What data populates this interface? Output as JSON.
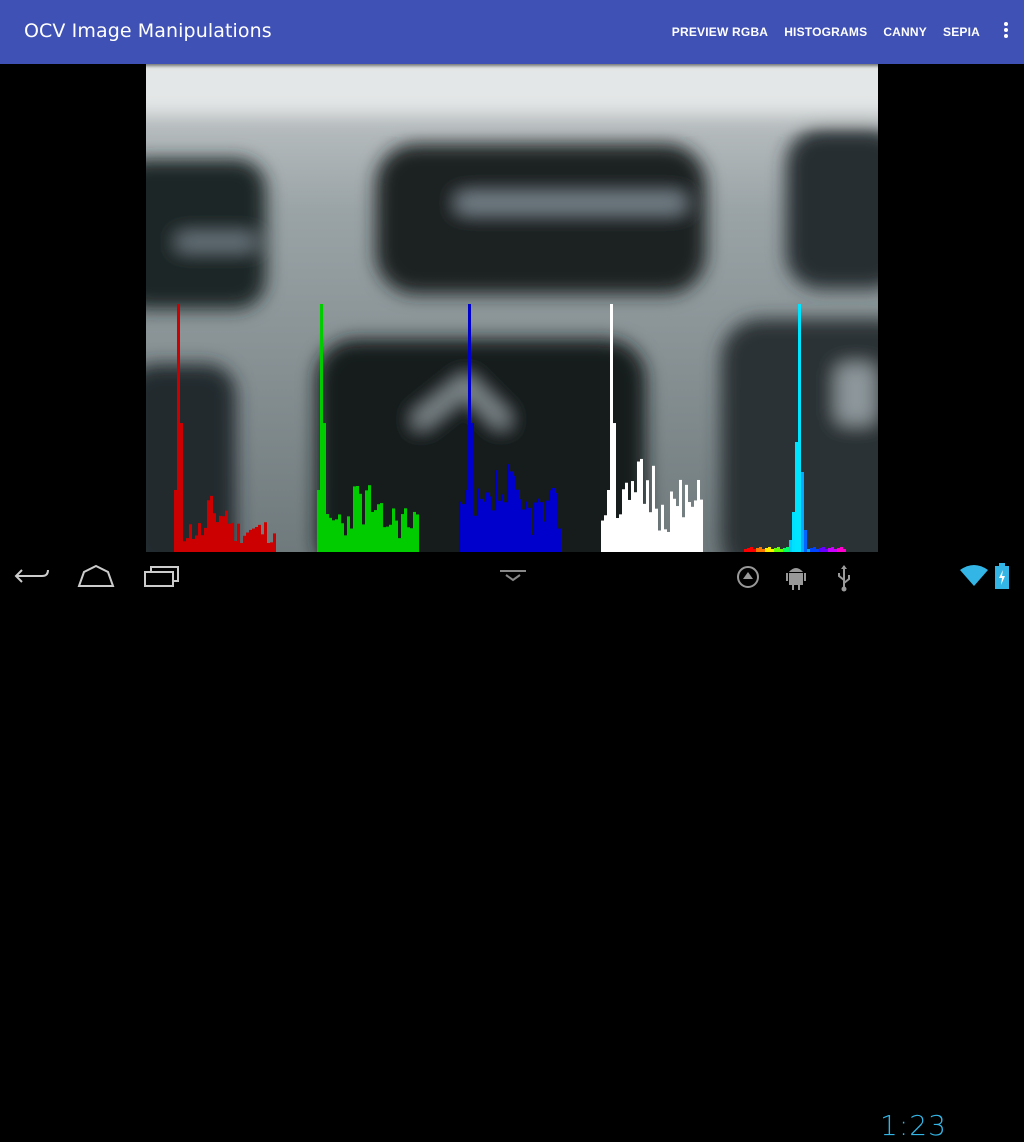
{
  "app": {
    "title": "OCV Image Manipulations"
  },
  "menu": {
    "items": [
      {
        "label": "PREVIEW RGBA"
      },
      {
        "label": "HISTOGRAMS"
      },
      {
        "label": "CANNY"
      },
      {
        "label": "SEPIA"
      }
    ],
    "overflow_icon": "more-vert-icon"
  },
  "histograms": {
    "channels": [
      {
        "name": "red",
        "color": "#cc0000"
      },
      {
        "name": "green",
        "color": "#00cc00"
      },
      {
        "name": "blue",
        "color": "#0000cc"
      },
      {
        "name": "value",
        "color": "#ffffff"
      },
      {
        "name": "hue",
        "color": "#00e5ff"
      }
    ]
  },
  "status_bar": {
    "time": "1:23",
    "icons": [
      "sync-icon",
      "android-debug-icon",
      "usb-icon",
      "wifi-icon",
      "battery-charging-icon"
    ]
  },
  "nav_bar": {
    "icons": [
      "back-icon",
      "home-icon",
      "recent-apps-icon",
      "keyboard-hide-icon"
    ]
  }
}
